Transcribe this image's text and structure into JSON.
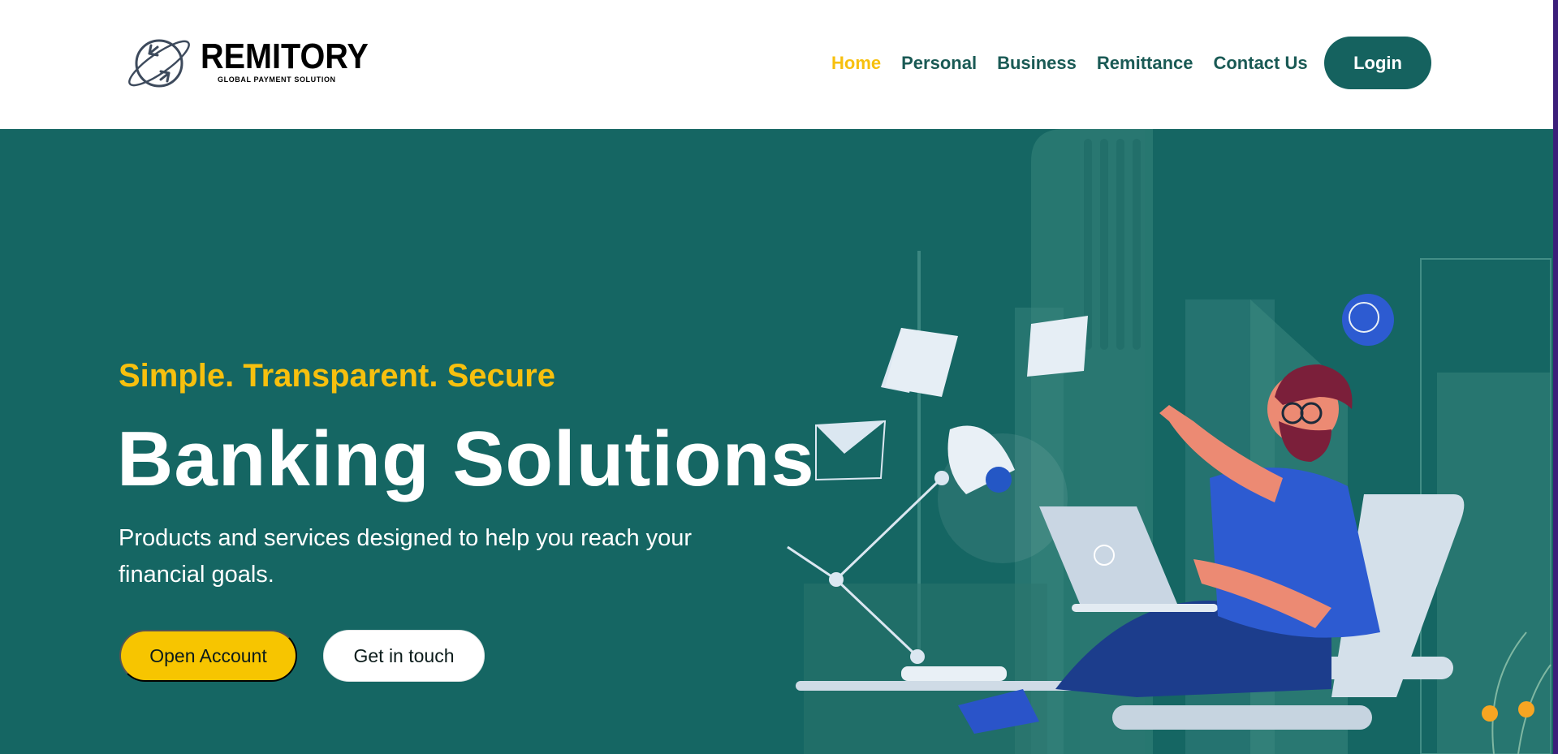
{
  "brand": {
    "name": "REMITORY",
    "tagline": "GLOBAL PAYMENT SOLUTION",
    "logo_icon": "globe-arrows-icon"
  },
  "nav": {
    "items": [
      {
        "label": "Home",
        "active": true
      },
      {
        "label": "Personal",
        "active": false
      },
      {
        "label": "Business",
        "active": false
      },
      {
        "label": "Remittance",
        "active": false
      },
      {
        "label": "Contact Us",
        "active": false
      }
    ],
    "login_label": "Login"
  },
  "hero": {
    "tagline": "Simple. Transparent. Secure",
    "headline": "Banking Solutions",
    "description": "Products and services designed to help you reach your financial goals.",
    "primary_button": "Open Account",
    "secondary_button": "Get in touch",
    "illustration": "man-working-on-laptop-illustration"
  },
  "colors": {
    "accent": "#f7c00e",
    "brand_teal": "#156663",
    "nav_text": "#1a5a55",
    "white": "#ffffff"
  }
}
